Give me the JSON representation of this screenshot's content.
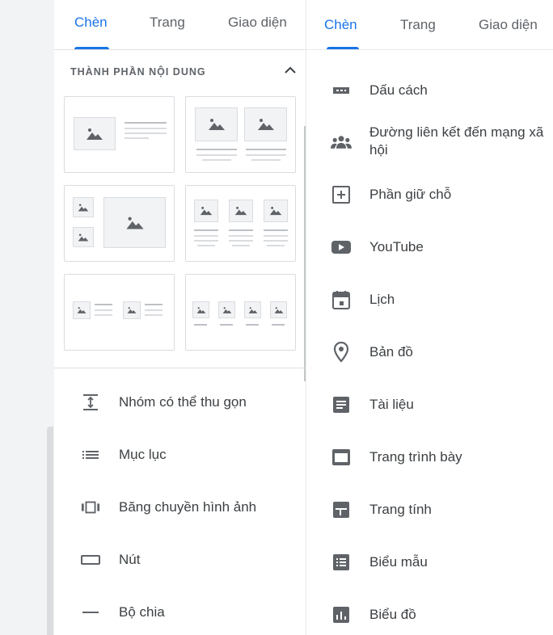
{
  "left_panel": {
    "tabs": [
      "Chèn",
      "Trang",
      "Giao diện"
    ],
    "active_tab": "Chèn",
    "section_title": "THÀNH PHẦN NỘI DUNG",
    "content_blocks_count": 6,
    "items": [
      {
        "label": "Nhóm có thể thu gọn",
        "icon": "collapsible-group-icon"
      },
      {
        "label": "Mục lục",
        "icon": "table-of-contents-icon"
      },
      {
        "label": "Băng chuyền hình ảnh",
        "icon": "image-carousel-icon"
      },
      {
        "label": "Nút",
        "icon": "button-icon"
      },
      {
        "label": "Bộ chia",
        "icon": "divider-icon"
      }
    ]
  },
  "right_panel": {
    "tabs": [
      "Chèn",
      "Trang",
      "Giao diện"
    ],
    "active_tab": "Chèn",
    "items": [
      {
        "label": "Dấu cách",
        "icon": "spacer-icon"
      },
      {
        "label": "Đường liên kết đến mạng xã hội",
        "icon": "social-links-icon"
      },
      {
        "label": "Phần giữ chỗ",
        "icon": "placeholder-icon"
      },
      {
        "label": "YouTube",
        "icon": "youtube-icon"
      },
      {
        "label": "Lịch",
        "icon": "calendar-icon"
      },
      {
        "label": "Bản đồ",
        "icon": "map-pin-icon"
      },
      {
        "label": "Tài liệu",
        "icon": "docs-icon"
      },
      {
        "label": "Trang trình bày",
        "icon": "slides-icon"
      },
      {
        "label": "Trang tính",
        "icon": "sheets-icon"
      },
      {
        "label": "Biểu mẫu",
        "icon": "forms-icon"
      },
      {
        "label": "Biểu đồ",
        "icon": "chart-icon"
      }
    ]
  },
  "colors": {
    "accent": "#1a73e8",
    "icon": "#5f6368",
    "text": "#3c4043",
    "border": "#dadce0",
    "gutter": "#f1f3f4"
  }
}
